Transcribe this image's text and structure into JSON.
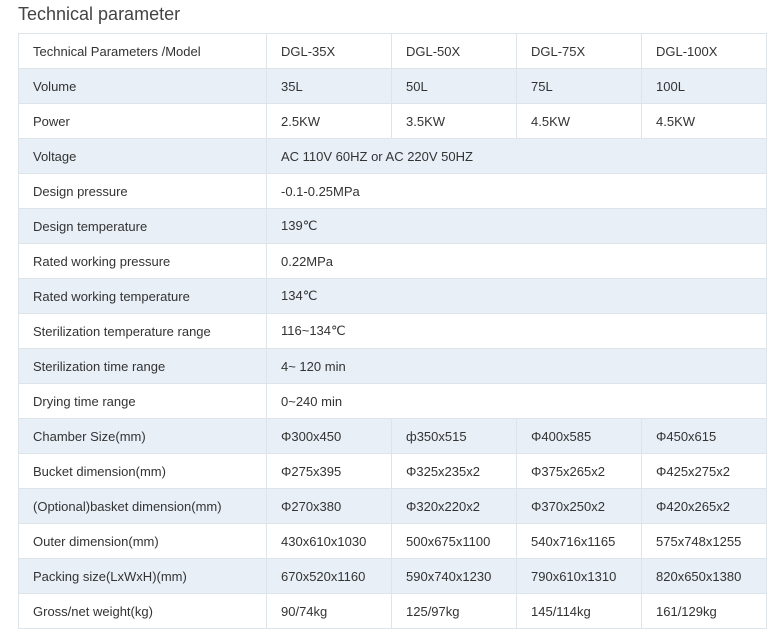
{
  "title": "Technical parameter",
  "header": [
    "Technical Parameters /Model",
    "DGL-35X",
    "DGL-50X",
    "DGL-75X",
    "DGL-100X"
  ],
  "rows": [
    {
      "label": "Volume",
      "values": [
        "35L",
        "50L",
        "75L",
        "100L"
      ]
    },
    {
      "label": "Power",
      "values": [
        "2.5KW",
        "3.5KW",
        "4.5KW",
        "4.5KW"
      ]
    },
    {
      "label": "Voltage",
      "values": [
        "AC 110V 60HZ or AC 220V 50HZ"
      ]
    },
    {
      "label": "Design pressure",
      "values": [
        "-0.1-0.25MPa"
      ]
    },
    {
      "label": "Design temperature",
      "values": [
        "139℃"
      ]
    },
    {
      "label": "Rated working pressure",
      "values": [
        "0.22MPa"
      ]
    },
    {
      "label": "Rated working temperature",
      "values": [
        "134℃"
      ]
    },
    {
      "label": "Sterilization temperature range",
      "values": [
        "116~134℃"
      ]
    },
    {
      "label": "Sterilization time range",
      "values": [
        "4~ 120 min"
      ]
    },
    {
      "label": "Drying time range",
      "values": [
        "0~240 min"
      ]
    },
    {
      "label": "Chamber Size(mm)",
      "values": [
        "Φ300x450",
        "ф350x515",
        "Φ400x585",
        "Φ450x615"
      ]
    },
    {
      "label": "Bucket dimension(mm)",
      "values": [
        "Φ275x395",
        "Φ325x235x2",
        "Φ375x265x2",
        "Φ425x275x2"
      ]
    },
    {
      "label": "(Optional)basket dimension(mm)",
      "values": [
        "Φ270x380",
        "Φ320x220x2",
        "Φ370x250x2",
        "Φ420x265x2"
      ]
    },
    {
      "label": "Outer dimension(mm)",
      "values": [
        "430x610x1030",
        "500x675x1100",
        "540x716x1165",
        "575x748x1255"
      ]
    },
    {
      "label": "Packing size(LxWxH)(mm)",
      "values": [
        "670x520x1160",
        "590x740x1230",
        "790x610x1310",
        "820x650x1380"
      ]
    },
    {
      "label": "Gross/net weight(kg)",
      "values": [
        "90/74kg",
        "125/97kg",
        "145/114kg",
        "161/129kg"
      ]
    }
  ],
  "colors": {
    "row_shade": "#e8eff7",
    "border": "#dde4ea",
    "text": "#333333"
  }
}
